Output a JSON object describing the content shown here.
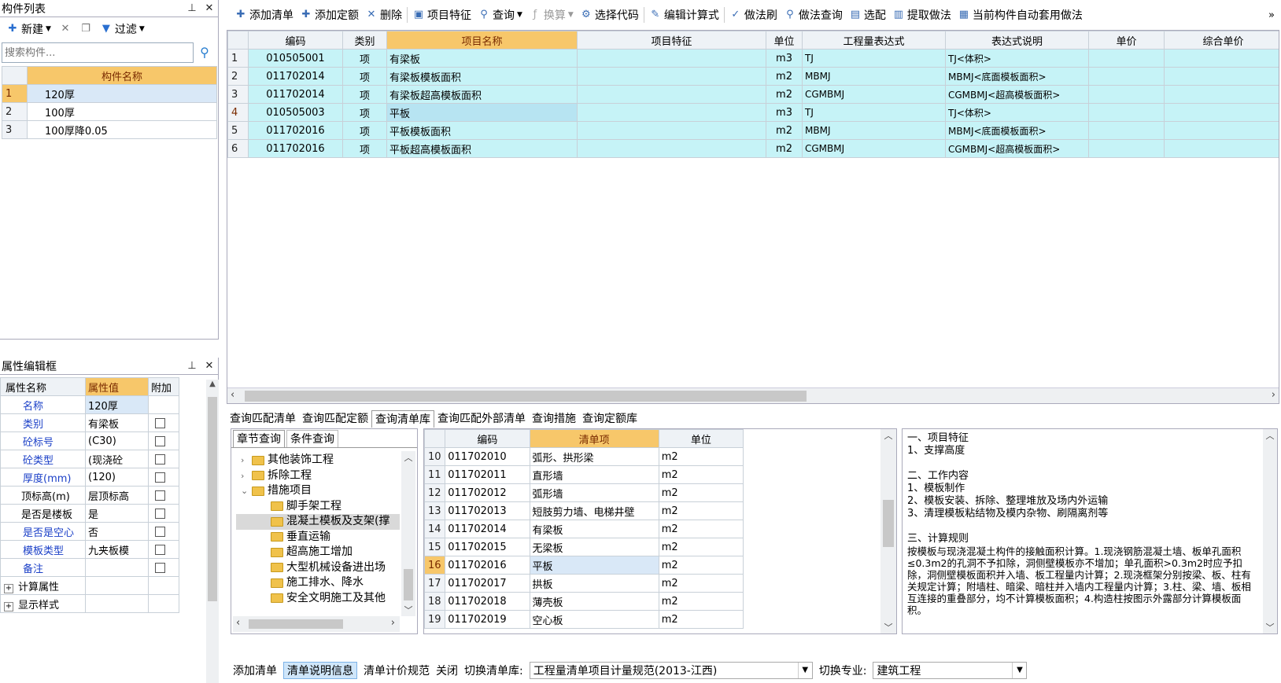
{
  "left_list": {
    "title": "构件列表",
    "pin": "ᵽ",
    "close": "✕",
    "toolbar": {
      "new": "新建",
      "filter": "过滤"
    },
    "search_placeholder": "搜索构件...",
    "header": "构件名称",
    "rows": [
      {
        "n": "1",
        "name": "120厚"
      },
      {
        "n": "2",
        "name": "100厚"
      },
      {
        "n": "3",
        "name": "100厚降0.05"
      }
    ]
  },
  "props": {
    "title": "属性编辑框",
    "headers": [
      "属性名称",
      "属性值",
      "附加"
    ],
    "rows": [
      {
        "name": "名称",
        "value": "120厚",
        "blue": true,
        "check": false
      },
      {
        "name": "类别",
        "value": "有梁板",
        "blue": true,
        "check": true
      },
      {
        "name": "砼标号",
        "value": "(C30)",
        "blue": true,
        "check": true
      },
      {
        "name": "砼类型",
        "value": "(现浇砼",
        "blue": true,
        "check": true
      },
      {
        "name": "厚度(mm)",
        "value": "(120)",
        "blue": true,
        "check": true
      },
      {
        "name": "顶标高(m)",
        "value": "层顶标高",
        "blue": false,
        "check": true
      },
      {
        "name": "是否是楼板",
        "value": "是",
        "blue": false,
        "check": true
      },
      {
        "name": "是否是空心",
        "value": "否",
        "blue": true,
        "check": true
      },
      {
        "name": "模板类型",
        "value": "九夹板模",
        "blue": true,
        "check": true
      },
      {
        "name": "备注",
        "value": "",
        "blue": true,
        "check": true
      }
    ],
    "groups": [
      "计算属性",
      "显示样式"
    ]
  },
  "main_toolbar": [
    "添加清单",
    "添加定额",
    "删除",
    "项目特征",
    "查询",
    "换算",
    "选择代码",
    "编辑计算式",
    "做法刷",
    "做法查询",
    "选配",
    "提取做法",
    "当前构件自动套用做法"
  ],
  "main_grid": {
    "headers": [
      "编码",
      "类别",
      "项目名称",
      "项目特征",
      "单位",
      "工程量表达式",
      "表达式说明",
      "单价",
      "综合单价"
    ],
    "rows": [
      {
        "n": "1",
        "code": "010505001",
        "type": "项",
        "name": "有梁板",
        "feat": "",
        "unit": "m3",
        "expr": "TJ",
        "desc": "TJ<体积>"
      },
      {
        "n": "2",
        "code": "011702014",
        "type": "项",
        "name": "有梁板模板面积",
        "feat": "",
        "unit": "m2",
        "expr": "MBMJ",
        "desc": "MBMJ<底面模板面积>"
      },
      {
        "n": "3",
        "code": "011702014",
        "type": "项",
        "name": "有梁板超高模板面积",
        "feat": "",
        "unit": "m2",
        "expr": "CGMBMJ",
        "desc": "CGMBMJ<超高模板面积>"
      },
      {
        "n": "4",
        "code": "010505003",
        "type": "项",
        "name": "平板",
        "feat": "",
        "unit": "m3",
        "expr": "TJ",
        "desc": "TJ<体积>"
      },
      {
        "n": "5",
        "code": "011702016",
        "type": "项",
        "name": "平板模板面积",
        "feat": "",
        "unit": "m2",
        "expr": "MBMJ",
        "desc": "MBMJ<底面模板面积>"
      },
      {
        "n": "6",
        "code": "011702016",
        "type": "项",
        "name": "平板超高模板面积",
        "feat": "",
        "unit": "m2",
        "expr": "CGMBMJ",
        "desc": "CGMBMJ<超高模板面积>"
      }
    ]
  },
  "query_tabs": [
    "查询匹配清单",
    "查询匹配定额",
    "查询清单库",
    "查询匹配外部清单",
    "查询措施",
    "查询定额库"
  ],
  "sub_tabs": [
    "章节查询",
    "条件查询"
  ],
  "tree": [
    {
      "label": "其他装饰工程",
      "level": 1,
      "arrow": "›"
    },
    {
      "label": "拆除工程",
      "level": 1,
      "arrow": "›"
    },
    {
      "label": "措施项目",
      "level": 1,
      "arrow": "⌄"
    },
    {
      "label": "脚手架工程",
      "level": 2,
      "arrow": ""
    },
    {
      "label": "混凝土模板及支架(撑",
      "level": 2,
      "arrow": ""
    },
    {
      "label": "垂直运输",
      "level": 2,
      "arrow": ""
    },
    {
      "label": "超高施工增加",
      "level": 2,
      "arrow": ""
    },
    {
      "label": "大型机械设备进出场",
      "level": 2,
      "arrow": ""
    },
    {
      "label": "施工排水、降水",
      "level": 2,
      "arrow": ""
    },
    {
      "label": "安全文明施工及其他",
      "level": 2,
      "arrow": ""
    }
  ],
  "lib_grid": {
    "headers": [
      "编码",
      "清单项",
      "单位"
    ],
    "rows": [
      {
        "n": "10",
        "code": "011702010",
        "name": "弧形、拱形梁",
        "unit": "m2"
      },
      {
        "n": "11",
        "code": "011702011",
        "name": "直形墙",
        "unit": "m2"
      },
      {
        "n": "12",
        "code": "011702012",
        "name": "弧形墙",
        "unit": "m2"
      },
      {
        "n": "13",
        "code": "011702013",
        "name": "短肢剪力墙、电梯井壁",
        "unit": "m2"
      },
      {
        "n": "14",
        "code": "011702014",
        "name": "有梁板",
        "unit": "m2"
      },
      {
        "n": "15",
        "code": "011702015",
        "name": "无梁板",
        "unit": "m2"
      },
      {
        "n": "16",
        "code": "011702016",
        "name": "平板",
        "unit": "m2"
      },
      {
        "n": "17",
        "code": "011702017",
        "name": "拱板",
        "unit": "m2"
      },
      {
        "n": "18",
        "code": "011702018",
        "name": "薄壳板",
        "unit": "m2"
      },
      {
        "n": "19",
        "code": "011702019",
        "name": "空心板",
        "unit": "m2"
      }
    ]
  },
  "desc_text": {
    "s1": "一、项目特征",
    "s1a": "1、支撑高度",
    "s2": "二、工作内容",
    "s2a": "1、模板制作",
    "s2b": "2、模板安装、拆除、整理堆放及场内外运输",
    "s2c": "3、清理模板粘结物及模内杂物、刷隔离剂等",
    "s3": "三、计算规则",
    "s3a": "按模板与现浇混凝土构件的接触面积计算。1.现浇钢筋混凝土墙、板单孔面积≤0.3m2的孔洞不予扣除，洞侧壁模板亦不增加；单孔面积>0.3m2时应予扣除，洞侧壁模板面积并入墙、板工程量内计算；2.现浇框架分别按梁、板、柱有关规定计算；附墙柱、暗梁、暗柱并入墙内工程量内计算；3.柱、梁、墙、板相互连接的重叠部分，均不计算模板面积；4.构造柱按图示外露部分计算模板面积。"
  },
  "bottom": {
    "add": "添加清单",
    "info": "清单说明信息",
    "rules": "清单计价规范",
    "close": "关闭",
    "lib_label": "切换清单库:",
    "lib_value": "工程量清单项目计量规范(2013-江西)",
    "major_label": "切换专业:",
    "major_value": "建筑工程"
  }
}
